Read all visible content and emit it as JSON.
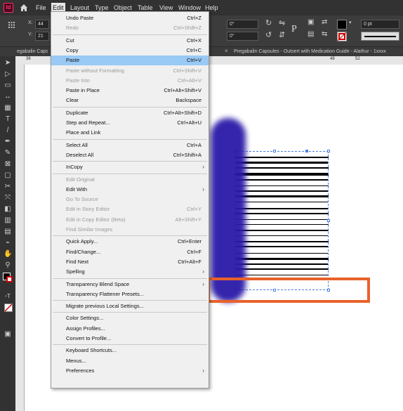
{
  "app": {
    "icon_label": "Id"
  },
  "menubar": {
    "items": [
      "File",
      "Edit",
      "Layout",
      "Type",
      "Object",
      "Table",
      "View",
      "Window",
      "Help"
    ],
    "active": "Edit"
  },
  "control_bar": {
    "x_field": "X:",
    "x_value": "44",
    "y_field": "Y:",
    "y_value": "21",
    "angle1": "0°",
    "angle2": "0°",
    "stroke": "0 pt"
  },
  "tabs": [
    "egabalin Capsu",
    "Pregabalin Capsules - Outsert with Medication Guide - Alathur - 1xxxx"
  ],
  "ruler_ticks": [
    "36",
    "48",
    "52"
  ],
  "edit_menu": [
    {
      "label": "Undo Paste",
      "shortcut": "Ctrl+Z",
      "disabled": false
    },
    {
      "label": "Redo",
      "shortcut": "Ctrl+Shift+Z",
      "disabled": true
    },
    {
      "sep": true
    },
    {
      "label": "Cut",
      "shortcut": "Ctrl+X",
      "disabled": false
    },
    {
      "label": "Copy",
      "shortcut": "Ctrl+C",
      "disabled": false
    },
    {
      "label": "Paste",
      "shortcut": "Ctrl+V",
      "disabled": false,
      "highlight": true
    },
    {
      "label": "Paste without Formatting",
      "shortcut": "Ctrl+Shift+V",
      "disabled": true
    },
    {
      "label": "Paste Into",
      "shortcut": "Ctrl+Alt+V",
      "disabled": true
    },
    {
      "label": "Paste in Place",
      "shortcut": "Ctrl+Alt+Shift+V",
      "disabled": false
    },
    {
      "label": "Clear",
      "shortcut": "Backspace",
      "disabled": false
    },
    {
      "sep": true
    },
    {
      "label": "Duplicate",
      "shortcut": "Ctrl+Alt+Shift+D",
      "disabled": false
    },
    {
      "label": "Step and Repeat...",
      "shortcut": "Ctrl+Alt+U",
      "disabled": false
    },
    {
      "label": "Place and Link",
      "shortcut": "",
      "disabled": false
    },
    {
      "sep": true
    },
    {
      "label": "Select All",
      "shortcut": "Ctrl+A",
      "disabled": false
    },
    {
      "label": "Deselect All",
      "shortcut": "Ctrl+Shift+A",
      "disabled": false
    },
    {
      "sep": true
    },
    {
      "label": "InCopy",
      "shortcut": "",
      "disabled": false,
      "submenu": true
    },
    {
      "sep": true
    },
    {
      "label": "Edit Original",
      "shortcut": "",
      "disabled": true
    },
    {
      "label": "Edit With",
      "shortcut": "",
      "disabled": false,
      "submenu": true
    },
    {
      "label": "Go To Source",
      "shortcut": "",
      "disabled": true
    },
    {
      "label": "Edit in Story Editor",
      "shortcut": "Ctrl+Y",
      "disabled": true
    },
    {
      "label": "Edit in Copy Editor (Beta)",
      "shortcut": "Alt+Shift+Y",
      "disabled": true
    },
    {
      "label": "Find Similar Images",
      "shortcut": "",
      "disabled": true
    },
    {
      "sep": true
    },
    {
      "label": "Quick Apply...",
      "shortcut": "Ctrl+Enter",
      "disabled": false
    },
    {
      "label": "Find/Change...",
      "shortcut": "Ctrl+F",
      "disabled": false
    },
    {
      "label": "Find Next",
      "shortcut": "Ctrl+Alt+F",
      "disabled": false
    },
    {
      "label": "Spelling",
      "shortcut": "",
      "disabled": false,
      "submenu": true
    },
    {
      "sep": true
    },
    {
      "label": "Transparency Blend Space",
      "shortcut": "",
      "disabled": false,
      "submenu": true
    },
    {
      "label": "Transparency Flattener Presets...",
      "shortcut": "",
      "disabled": false
    },
    {
      "sep": true
    },
    {
      "label": "Migrate previous Local Settings...",
      "shortcut": "",
      "disabled": false
    },
    {
      "sep": true
    },
    {
      "label": "Color Settings...",
      "shortcut": "",
      "disabled": false
    },
    {
      "label": "Assign Profiles...",
      "shortcut": "",
      "disabled": false
    },
    {
      "label": "Convert to Profile...",
      "shortcut": "",
      "disabled": false
    },
    {
      "sep": true
    },
    {
      "label": "Keyboard Shortcuts...",
      "shortcut": "",
      "disabled": false
    },
    {
      "label": "Menus...",
      "shortcut": "",
      "disabled": false
    },
    {
      "label": "Preferences",
      "shortcut": "",
      "disabled": false,
      "submenu": true
    }
  ],
  "colors": {
    "accent_highlight": "#99c9f5",
    "annotation": "#e8622a",
    "scribble": "#2a1aa8"
  }
}
